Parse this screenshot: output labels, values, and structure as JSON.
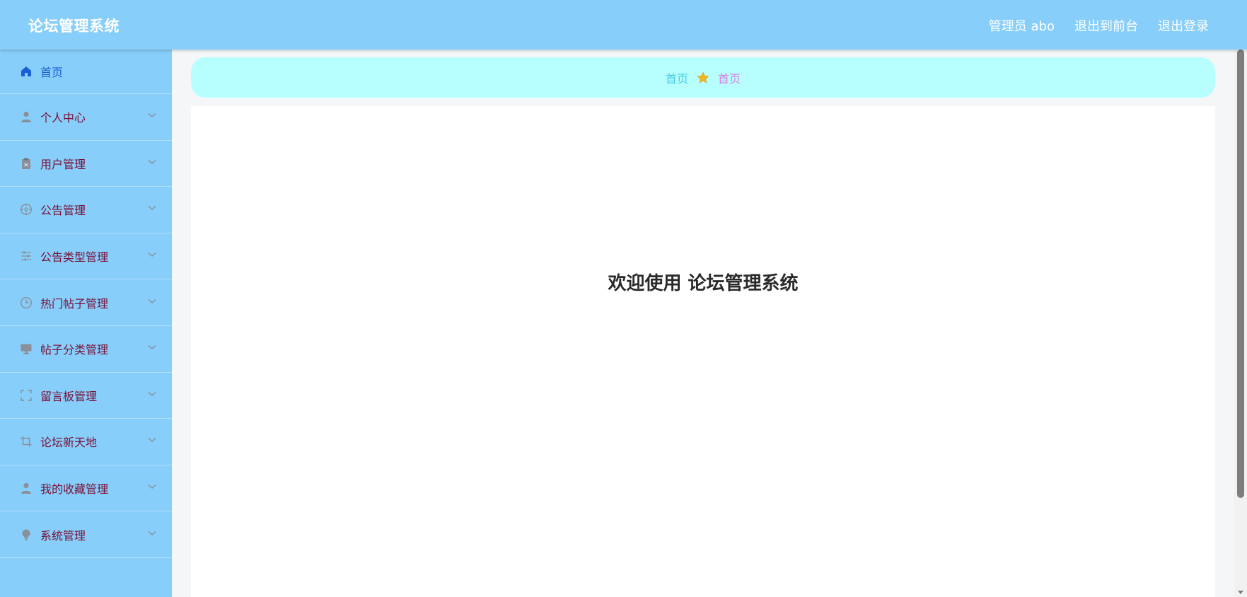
{
  "header": {
    "title": "论坛管理系统",
    "admin": "管理员 abo",
    "to_front": "退出到前台",
    "logout": "退出登录"
  },
  "sidebar": {
    "items": [
      {
        "label": "首页",
        "icon": "home-icon"
      },
      {
        "label": "个人中心",
        "icon": "user-icon"
      },
      {
        "label": "用户管理",
        "icon": "clipboard-icon"
      },
      {
        "label": "公告管理",
        "icon": "compass-icon"
      },
      {
        "label": "公告类型管理",
        "icon": "sliders-icon"
      },
      {
        "label": "热门帖子管理",
        "icon": "clock-icon"
      },
      {
        "label": "帖子分类管理",
        "icon": "monitor-icon"
      },
      {
        "label": "留言板管理",
        "icon": "fullscreen-icon"
      },
      {
        "label": "论坛新天地",
        "icon": "crop-icon"
      },
      {
        "label": "我的收藏管理",
        "icon": "user-icon"
      },
      {
        "label": "系统管理",
        "icon": "bulb-icon"
      }
    ]
  },
  "breadcrumb": {
    "home": "首页",
    "current": "首页",
    "separator_icon": "star-icon"
  },
  "main": {
    "welcome": "欢迎使用 论坛管理系统"
  },
  "colors": {
    "header_bg": "#87cefa",
    "sidebar_bg": "#87cefa",
    "breadcrumb_bg": "#b7ffff",
    "menu_text": "#7a1036",
    "active_text": "#1a5fd6"
  }
}
